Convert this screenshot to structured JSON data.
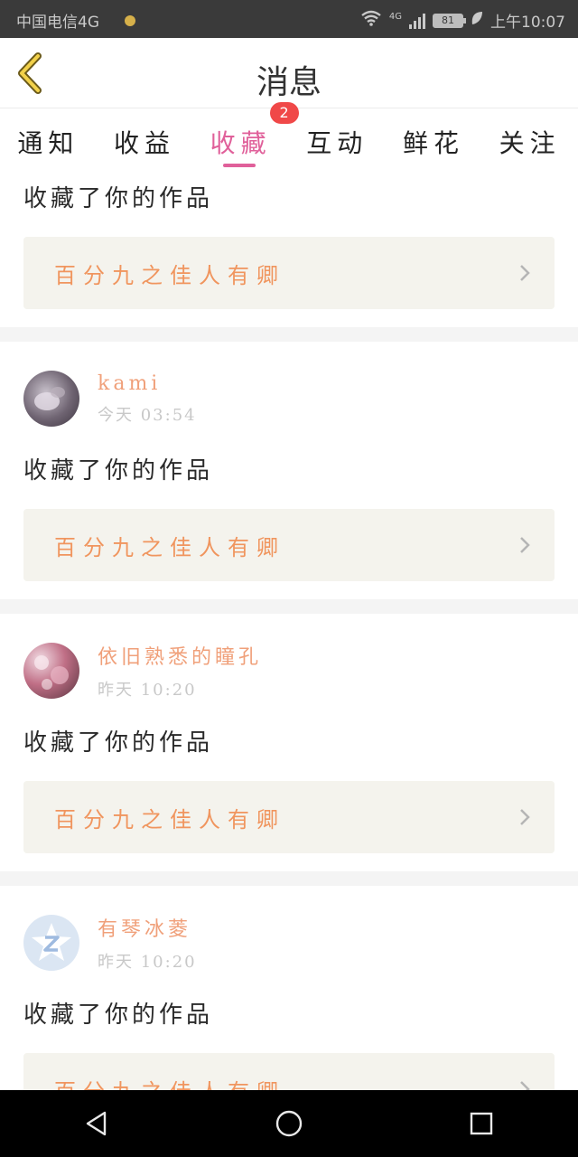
{
  "status_bar": {
    "carrier": "中国电信4G",
    "network": "4G",
    "battery": "81",
    "time": "上午10:07"
  },
  "header": {
    "title": "消息",
    "back_icon": "chevron-left-icon"
  },
  "tabs": [
    {
      "label": "通知",
      "active": false
    },
    {
      "label": "收益",
      "active": false
    },
    {
      "label": "收藏",
      "active": true,
      "badge": "2"
    },
    {
      "label": "互动",
      "active": false
    },
    {
      "label": "鲜花",
      "active": false
    },
    {
      "label": "关注",
      "active": false
    }
  ],
  "feed": {
    "partial_item": {
      "action": "收藏了你的作品",
      "work_title": "百分九之佳人有卿"
    },
    "items": [
      {
        "username": "kami",
        "time": "今天 03:54",
        "action": "收藏了你的作品",
        "work_title": "百分九之佳人有卿"
      },
      {
        "username": "依旧熟悉的瞳孔",
        "time": "昨天 10:20",
        "action": "收藏了你的作品",
        "work_title": "百分九之佳人有卿"
      },
      {
        "username": "有琴冰菱",
        "time": "昨天 10:20",
        "action": "收藏了你的作品",
        "work_title": "百分九之佳人有卿"
      }
    ]
  },
  "colors": {
    "accent": "#e0609a",
    "username": "#f0a07a",
    "work_title": "#f0955e",
    "badge": "#f04848",
    "card_bg": "#f4f3ed"
  },
  "nav_bar": {
    "back_icon": "triangle-back-icon",
    "home_icon": "circle-home-icon",
    "recents_icon": "square-recents-icon"
  }
}
